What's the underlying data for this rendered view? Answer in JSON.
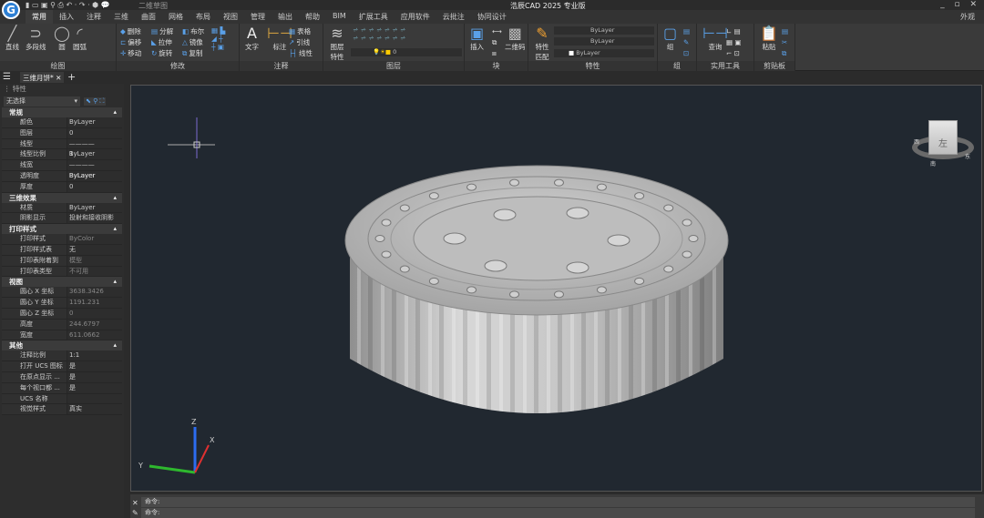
{
  "app": {
    "title": "浩辰CAD 2025 专业版",
    "doc_name": "二维草图",
    "logo": "G"
  },
  "menu": [
    "常用",
    "插入",
    "注释",
    "三维",
    "曲面",
    "网格",
    "布局",
    "视图",
    "管理",
    "输出",
    "帮助",
    "BIM",
    "扩展工具",
    "应用软件",
    "云批注",
    "协同设计"
  ],
  "appearance": "外观",
  "ribbon": {
    "draw": {
      "label": "绘图",
      "line": "直线",
      "polyline": "多段线",
      "circle": "圆",
      "arc": "圆弧"
    },
    "modify": {
      "label": "修改",
      "erase": "删除",
      "explode": "分解",
      "boolean": "布尔",
      "offset": "偏移",
      "stretch": "拉伸",
      "mirror": "镜像",
      "move": "移动",
      "rotate": "旋转",
      "copy": "复制"
    },
    "annotate": {
      "label": "注释",
      "text": "文字",
      "dim": "标注",
      "table": "表格",
      "leader": "引线",
      "linear": "线性"
    },
    "layer": {
      "label": "图层",
      "props": "图层特性",
      "current": "0"
    },
    "block": {
      "label": "块",
      "insert": "插入",
      "qrcode": "二维码"
    },
    "properties": {
      "label": "特性",
      "match": "特性匹配",
      "color": "ByLayer",
      "linetype": "ByLayer",
      "lineweight": "ByLayer"
    },
    "group": {
      "label": "组",
      "group": "组"
    },
    "utilities": {
      "label": "实用工具",
      "query": "查询"
    },
    "clipboard": {
      "label": "剪贴板",
      "paste": "粘贴"
    }
  },
  "tab": {
    "name": "三维月饼*"
  },
  "panel": {
    "title": "特性",
    "selection": "无选择",
    "sections": [
      {
        "name": "常规",
        "rows": [
          [
            "颜色",
            "ByLayer"
          ],
          [
            "图层",
            "0"
          ],
          [
            "线型",
            "———— ByLayer"
          ],
          [
            "线型比例",
            "1"
          ],
          [
            "线宽",
            "———— ByLayer"
          ],
          [
            "透明度",
            "ByLayer"
          ],
          [
            "厚度",
            "0"
          ]
        ]
      },
      {
        "name": "三维效果",
        "rows": [
          [
            "材质",
            "ByLayer"
          ],
          [
            "阴影显示",
            "投射和接收阴影"
          ]
        ]
      },
      {
        "name": "打印样式",
        "rows": [
          [
            "打印样式",
            "ByColor"
          ],
          [
            "打印样式表",
            "无"
          ],
          [
            "打印表附着到",
            "模型"
          ],
          [
            "打印表类型",
            "不可用"
          ]
        ]
      },
      {
        "name": "视图",
        "rows": [
          [
            "圆心 X 坐标",
            "3638.3426"
          ],
          [
            "圆心 Y 坐标",
            "1191.231"
          ],
          [
            "圆心 Z 坐标",
            "0"
          ],
          [
            "高度",
            "244.6797"
          ],
          [
            "宽度",
            "611.0662"
          ]
        ]
      },
      {
        "name": "其他",
        "rows": [
          [
            "注释比例",
            "1:1"
          ],
          [
            "打开 UCS 图标",
            "是"
          ],
          [
            "在原点显示 ...",
            "是"
          ],
          [
            "每个视口都 ...",
            "是"
          ],
          [
            "UCS 名称",
            ""
          ],
          [
            "视觉样式",
            "真实"
          ]
        ]
      }
    ]
  },
  "viewcube": {
    "face": "左",
    "ring": [
      "西",
      "南",
      "东"
    ]
  },
  "command": {
    "line1": "命令:",
    "line2": "命令:"
  }
}
